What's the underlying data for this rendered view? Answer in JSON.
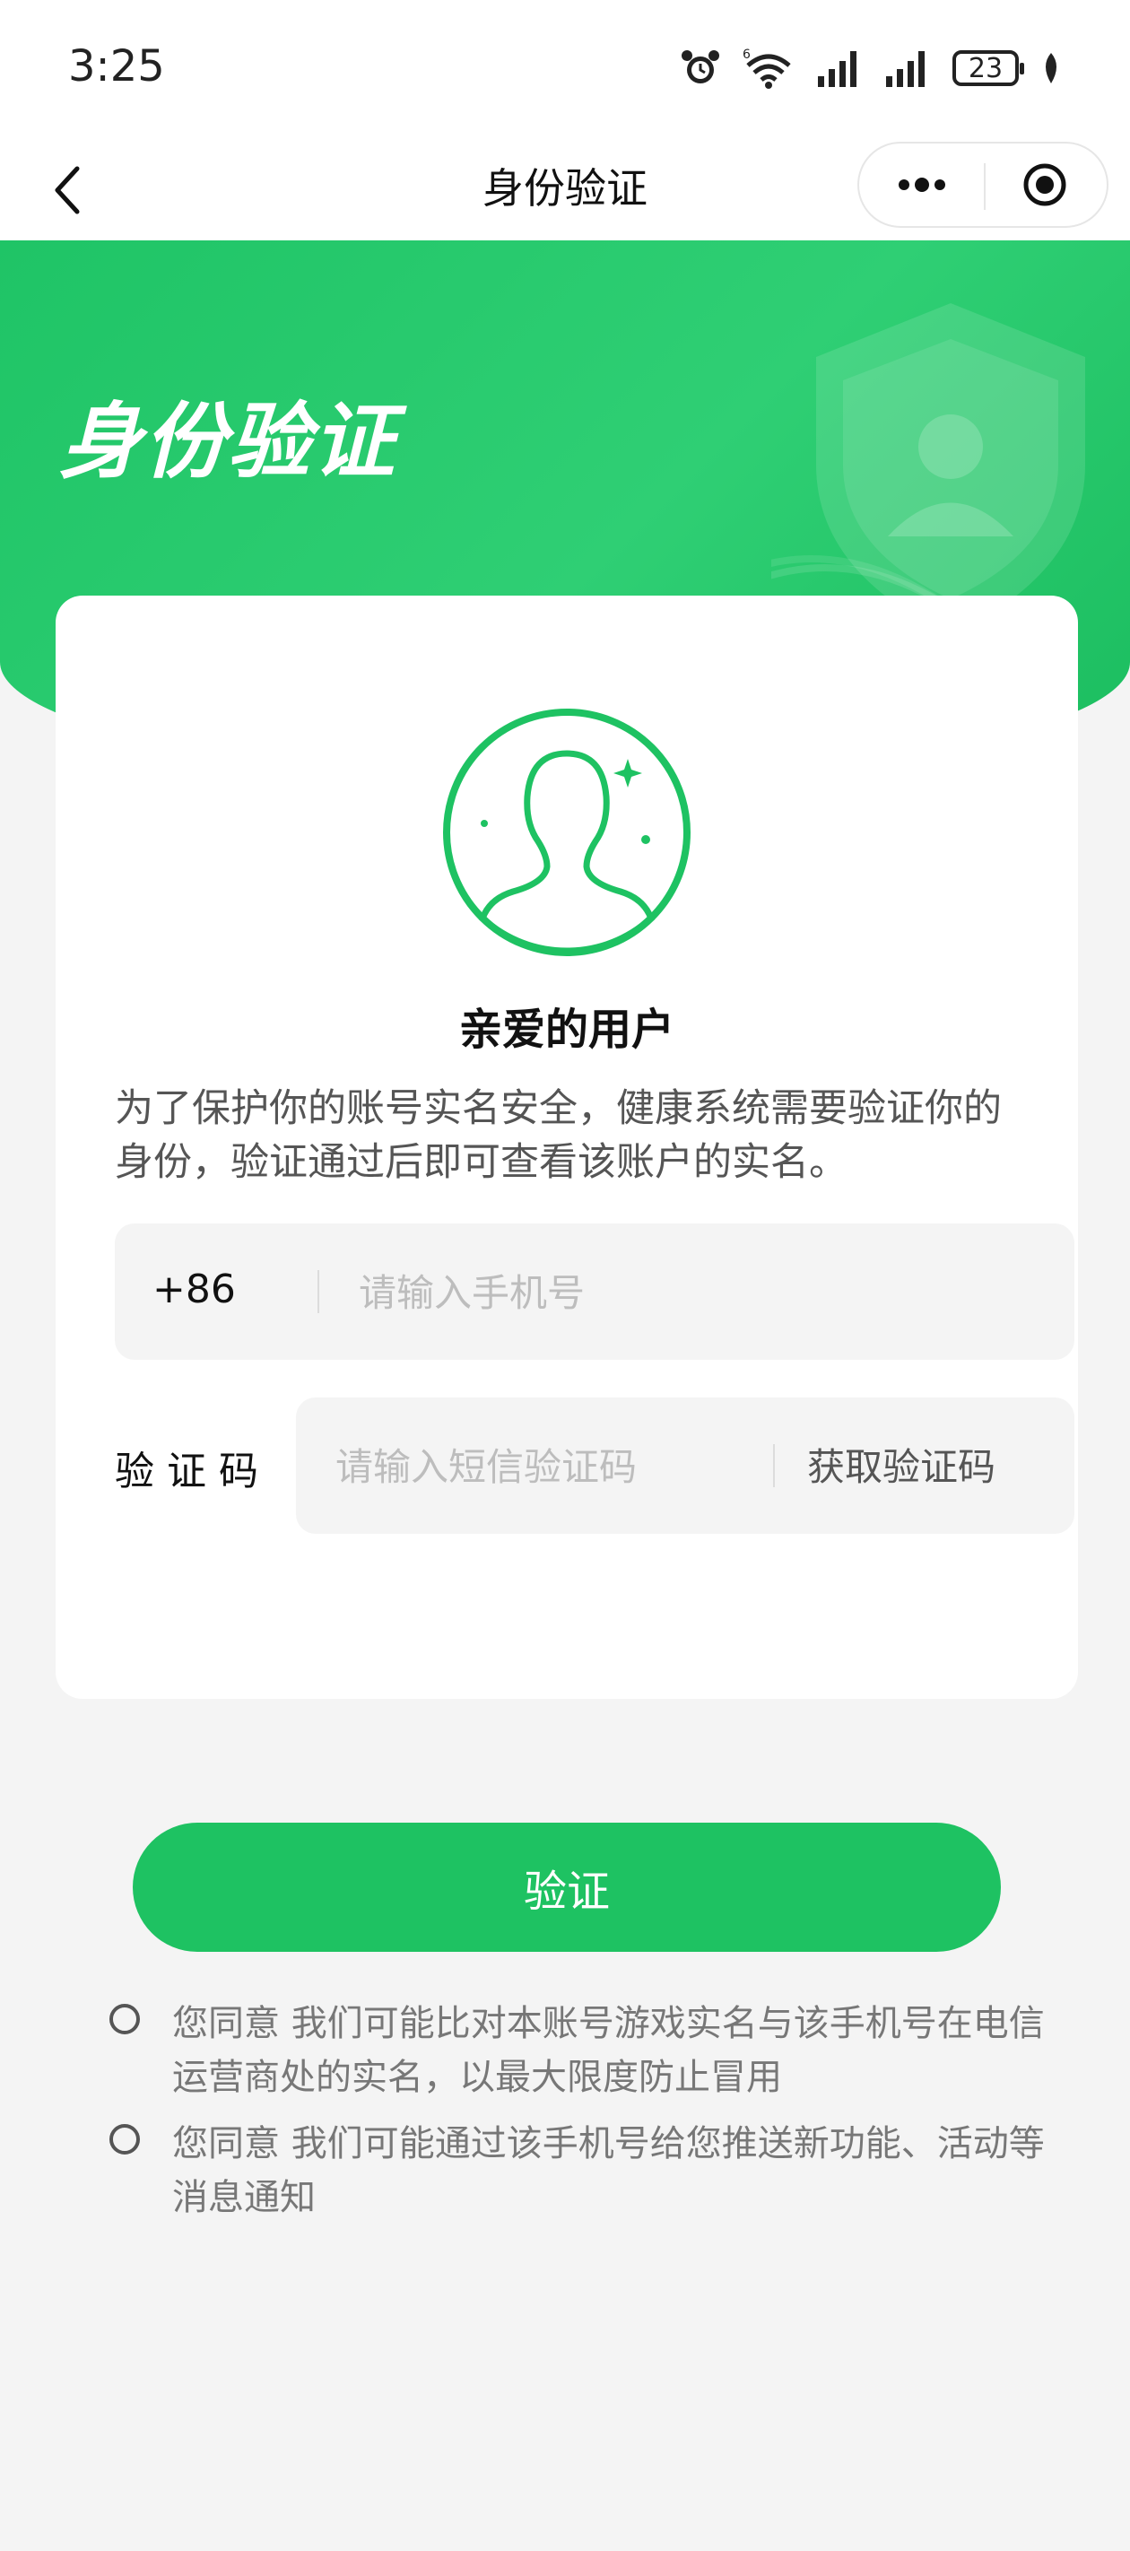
{
  "status_bar": {
    "time": "3:25",
    "battery": "23",
    "icons": [
      "alarm-icon",
      "wifi-icon",
      "signal-icon",
      "signal-icon",
      "battery-icon",
      "leaf-icon"
    ]
  },
  "nav": {
    "title": "身份验证",
    "back_icon": "chevron-left-icon",
    "more_icon": "more-dots-icon",
    "close_icon": "target-close-icon"
  },
  "hero": {
    "title": "身份验证",
    "decoration_icon": "shield-user-icon"
  },
  "card": {
    "avatar_icon": "user-avatar-icon",
    "greeting": "亲爱的用户",
    "description": "为了保护你的账号实名安全，健康系统需要验证你的身份，验证通过后即可查看该账户的实名。",
    "phone": {
      "country_code": "+86",
      "placeholder": "请输入手机号",
      "value": ""
    },
    "code": {
      "label": "验证码",
      "placeholder": "请输入短信验证码",
      "value": "",
      "get_code_label": "获取验证码"
    }
  },
  "verify_button": "验证",
  "agreements": [
    {
      "text": "您同意 我们可能比对本账号游戏实名与该手机号在电信运营商处的实名，以最大限度防止冒用",
      "checked": false
    },
    {
      "text": "您同意 我们可能通过该手机号给您推送新功能、活动等消息通知",
      "checked": false
    }
  ],
  "colors": {
    "brand_green": "#1ec262",
    "background": "#f4f4f4",
    "card": "#ffffff"
  }
}
